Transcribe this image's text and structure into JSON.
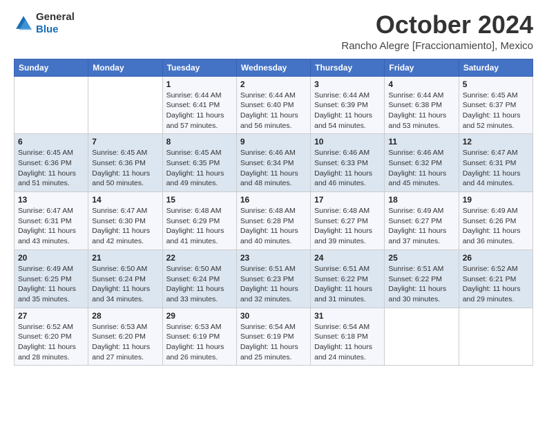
{
  "header": {
    "logo_line1": "General",
    "logo_line2": "Blue",
    "month_title": "October 2024",
    "subtitle": "Rancho Alegre [Fraccionamiento], Mexico"
  },
  "weekdays": [
    "Sunday",
    "Monday",
    "Tuesday",
    "Wednesday",
    "Thursday",
    "Friday",
    "Saturday"
  ],
  "weeks": [
    [
      {
        "day": "",
        "info": ""
      },
      {
        "day": "",
        "info": ""
      },
      {
        "day": "1",
        "info": "Sunrise: 6:44 AM\nSunset: 6:41 PM\nDaylight: 11 hours and 57 minutes."
      },
      {
        "day": "2",
        "info": "Sunrise: 6:44 AM\nSunset: 6:40 PM\nDaylight: 11 hours and 56 minutes."
      },
      {
        "day": "3",
        "info": "Sunrise: 6:44 AM\nSunset: 6:39 PM\nDaylight: 11 hours and 54 minutes."
      },
      {
        "day": "4",
        "info": "Sunrise: 6:44 AM\nSunset: 6:38 PM\nDaylight: 11 hours and 53 minutes."
      },
      {
        "day": "5",
        "info": "Sunrise: 6:45 AM\nSunset: 6:37 PM\nDaylight: 11 hours and 52 minutes."
      }
    ],
    [
      {
        "day": "6",
        "info": "Sunrise: 6:45 AM\nSunset: 6:36 PM\nDaylight: 11 hours and 51 minutes."
      },
      {
        "day": "7",
        "info": "Sunrise: 6:45 AM\nSunset: 6:36 PM\nDaylight: 11 hours and 50 minutes."
      },
      {
        "day": "8",
        "info": "Sunrise: 6:45 AM\nSunset: 6:35 PM\nDaylight: 11 hours and 49 minutes."
      },
      {
        "day": "9",
        "info": "Sunrise: 6:46 AM\nSunset: 6:34 PM\nDaylight: 11 hours and 48 minutes."
      },
      {
        "day": "10",
        "info": "Sunrise: 6:46 AM\nSunset: 6:33 PM\nDaylight: 11 hours and 46 minutes."
      },
      {
        "day": "11",
        "info": "Sunrise: 6:46 AM\nSunset: 6:32 PM\nDaylight: 11 hours and 45 minutes."
      },
      {
        "day": "12",
        "info": "Sunrise: 6:47 AM\nSunset: 6:31 PM\nDaylight: 11 hours and 44 minutes."
      }
    ],
    [
      {
        "day": "13",
        "info": "Sunrise: 6:47 AM\nSunset: 6:31 PM\nDaylight: 11 hours and 43 minutes."
      },
      {
        "day": "14",
        "info": "Sunrise: 6:47 AM\nSunset: 6:30 PM\nDaylight: 11 hours and 42 minutes."
      },
      {
        "day": "15",
        "info": "Sunrise: 6:48 AM\nSunset: 6:29 PM\nDaylight: 11 hours and 41 minutes."
      },
      {
        "day": "16",
        "info": "Sunrise: 6:48 AM\nSunset: 6:28 PM\nDaylight: 11 hours and 40 minutes."
      },
      {
        "day": "17",
        "info": "Sunrise: 6:48 AM\nSunset: 6:27 PM\nDaylight: 11 hours and 39 minutes."
      },
      {
        "day": "18",
        "info": "Sunrise: 6:49 AM\nSunset: 6:27 PM\nDaylight: 11 hours and 37 minutes."
      },
      {
        "day": "19",
        "info": "Sunrise: 6:49 AM\nSunset: 6:26 PM\nDaylight: 11 hours and 36 minutes."
      }
    ],
    [
      {
        "day": "20",
        "info": "Sunrise: 6:49 AM\nSunset: 6:25 PM\nDaylight: 11 hours and 35 minutes."
      },
      {
        "day": "21",
        "info": "Sunrise: 6:50 AM\nSunset: 6:24 PM\nDaylight: 11 hours and 34 minutes."
      },
      {
        "day": "22",
        "info": "Sunrise: 6:50 AM\nSunset: 6:24 PM\nDaylight: 11 hours and 33 minutes."
      },
      {
        "day": "23",
        "info": "Sunrise: 6:51 AM\nSunset: 6:23 PM\nDaylight: 11 hours and 32 minutes."
      },
      {
        "day": "24",
        "info": "Sunrise: 6:51 AM\nSunset: 6:22 PM\nDaylight: 11 hours and 31 minutes."
      },
      {
        "day": "25",
        "info": "Sunrise: 6:51 AM\nSunset: 6:22 PM\nDaylight: 11 hours and 30 minutes."
      },
      {
        "day": "26",
        "info": "Sunrise: 6:52 AM\nSunset: 6:21 PM\nDaylight: 11 hours and 29 minutes."
      }
    ],
    [
      {
        "day": "27",
        "info": "Sunrise: 6:52 AM\nSunset: 6:20 PM\nDaylight: 11 hours and 28 minutes."
      },
      {
        "day": "28",
        "info": "Sunrise: 6:53 AM\nSunset: 6:20 PM\nDaylight: 11 hours and 27 minutes."
      },
      {
        "day": "29",
        "info": "Sunrise: 6:53 AM\nSunset: 6:19 PM\nDaylight: 11 hours and 26 minutes."
      },
      {
        "day": "30",
        "info": "Sunrise: 6:54 AM\nSunset: 6:19 PM\nDaylight: 11 hours and 25 minutes."
      },
      {
        "day": "31",
        "info": "Sunrise: 6:54 AM\nSunset: 6:18 PM\nDaylight: 11 hours and 24 minutes."
      },
      {
        "day": "",
        "info": ""
      },
      {
        "day": "",
        "info": ""
      }
    ]
  ]
}
